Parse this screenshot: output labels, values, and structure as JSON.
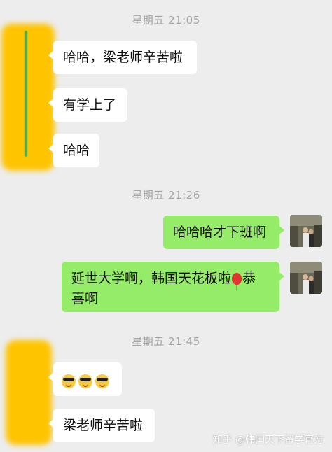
{
  "timestamps": [
    "星期五 21:05",
    "星期五 21:26",
    "星期五 21:45"
  ],
  "messages": {
    "m1": "哈哈，梁老师辛苦啦",
    "m2": "有学上了",
    "m3": "哈哈",
    "m4": "哈哈哈才下班啊",
    "m5a": "延世大学啊，韩国天花板啦",
    "m5b": "恭",
    "m5c": "喜啊",
    "m7": "梁老师辛苦啦"
  },
  "icons": {
    "balloon": "balloon-emoji",
    "sunglasses": "sunglasses-emoji"
  },
  "colors": {
    "background": "#ededed",
    "incoming": "#ffffff",
    "outgoing": "#95ec69",
    "redaction": "#ffc400"
  },
  "watermark": "知乎 @韩国天下留学官方"
}
